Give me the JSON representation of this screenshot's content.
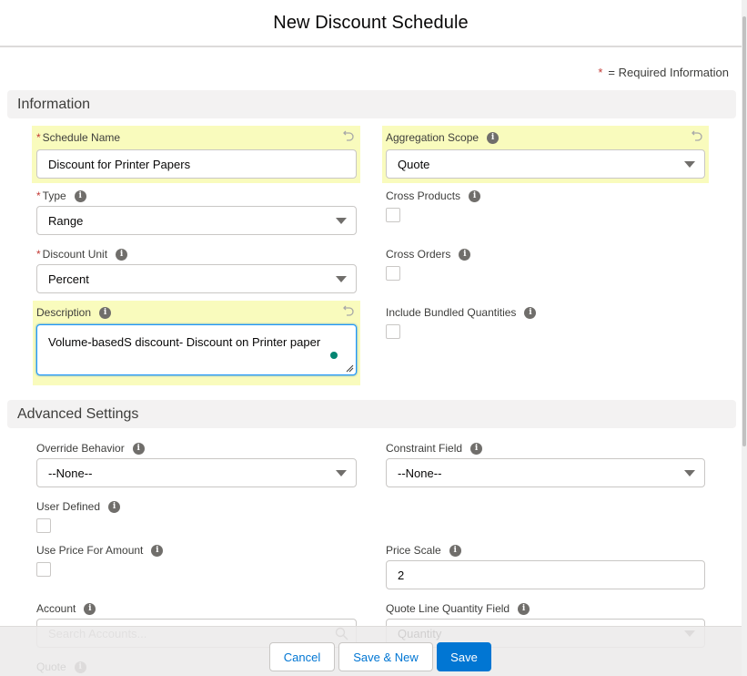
{
  "modal": {
    "title": "New Discount Schedule",
    "required_note": "= Required Information",
    "required_marker": "*"
  },
  "sections": {
    "information": "Information",
    "advanced": "Advanced Settings"
  },
  "fields": {
    "schedule_name": {
      "label": "Schedule Name",
      "required": true,
      "value": "Discount for Printer Papers",
      "highlighted": true
    },
    "aggregation_scope": {
      "label": "Aggregation Scope",
      "value": "Quote",
      "highlighted": true
    },
    "type": {
      "label": "Type",
      "required": true,
      "value": "Range"
    },
    "cross_products": {
      "label": "Cross Products",
      "checked": false
    },
    "discount_unit": {
      "label": "Discount Unit",
      "required": true,
      "value": "Percent"
    },
    "cross_orders": {
      "label": "Cross Orders",
      "checked": false
    },
    "description": {
      "label": "Description",
      "value": "Volume-basedS discount- Discount on Printer paper",
      "highlighted": true
    },
    "include_bundled_quantities": {
      "label": "Include Bundled Quantities",
      "checked": false
    },
    "override_behavior": {
      "label": "Override Behavior",
      "value": "--None--"
    },
    "constraint_field": {
      "label": "Constraint Field",
      "value": "--None--"
    },
    "user_defined": {
      "label": "User Defined",
      "checked": false
    },
    "use_price_for_amount": {
      "label": "Use Price For Amount",
      "checked": false
    },
    "price_scale": {
      "label": "Price Scale",
      "value": "2"
    },
    "account": {
      "label": "Account",
      "placeholder": "Search Accounts..."
    },
    "quote_line_quantity_field": {
      "label": "Quote Line Quantity Field",
      "value": "Quantity"
    },
    "quote": {
      "label": "Quote"
    }
  },
  "footer": {
    "cancel": "Cancel",
    "save_new": "Save & New",
    "save": "Save"
  },
  "colors": {
    "brand": "#0176d3",
    "highlight": "#f9fbbd",
    "required": "#c23934",
    "section_bg": "#f3f2f2"
  }
}
